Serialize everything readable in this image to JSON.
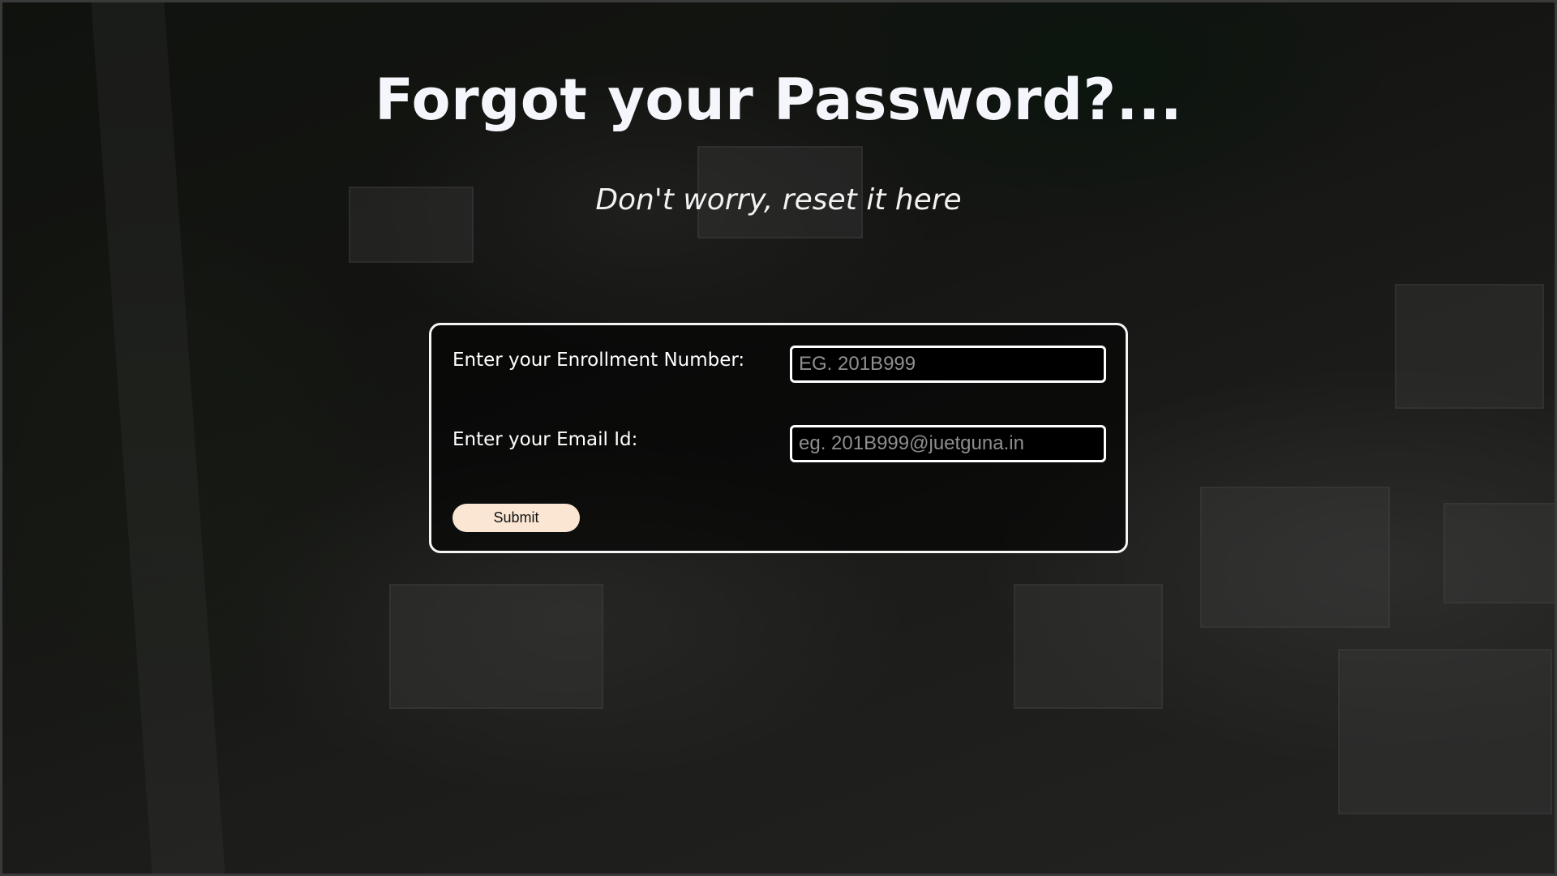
{
  "page": {
    "title": "Forgot your Password?...",
    "subtitle": "Don't worry, reset it here"
  },
  "form": {
    "enrollment": {
      "label": "Enter your Enrollment Number:",
      "placeholder": "EG. 201B999",
      "value": ""
    },
    "email": {
      "label": "Enter your Email Id:",
      "placeholder": "eg. 201B999@juetguna.in",
      "value": ""
    },
    "submit_label": "Submit"
  },
  "colors": {
    "form_border": "#f5f5f5",
    "submit_background": "#fbe6d3",
    "placeholder": "#8f8f8f"
  }
}
